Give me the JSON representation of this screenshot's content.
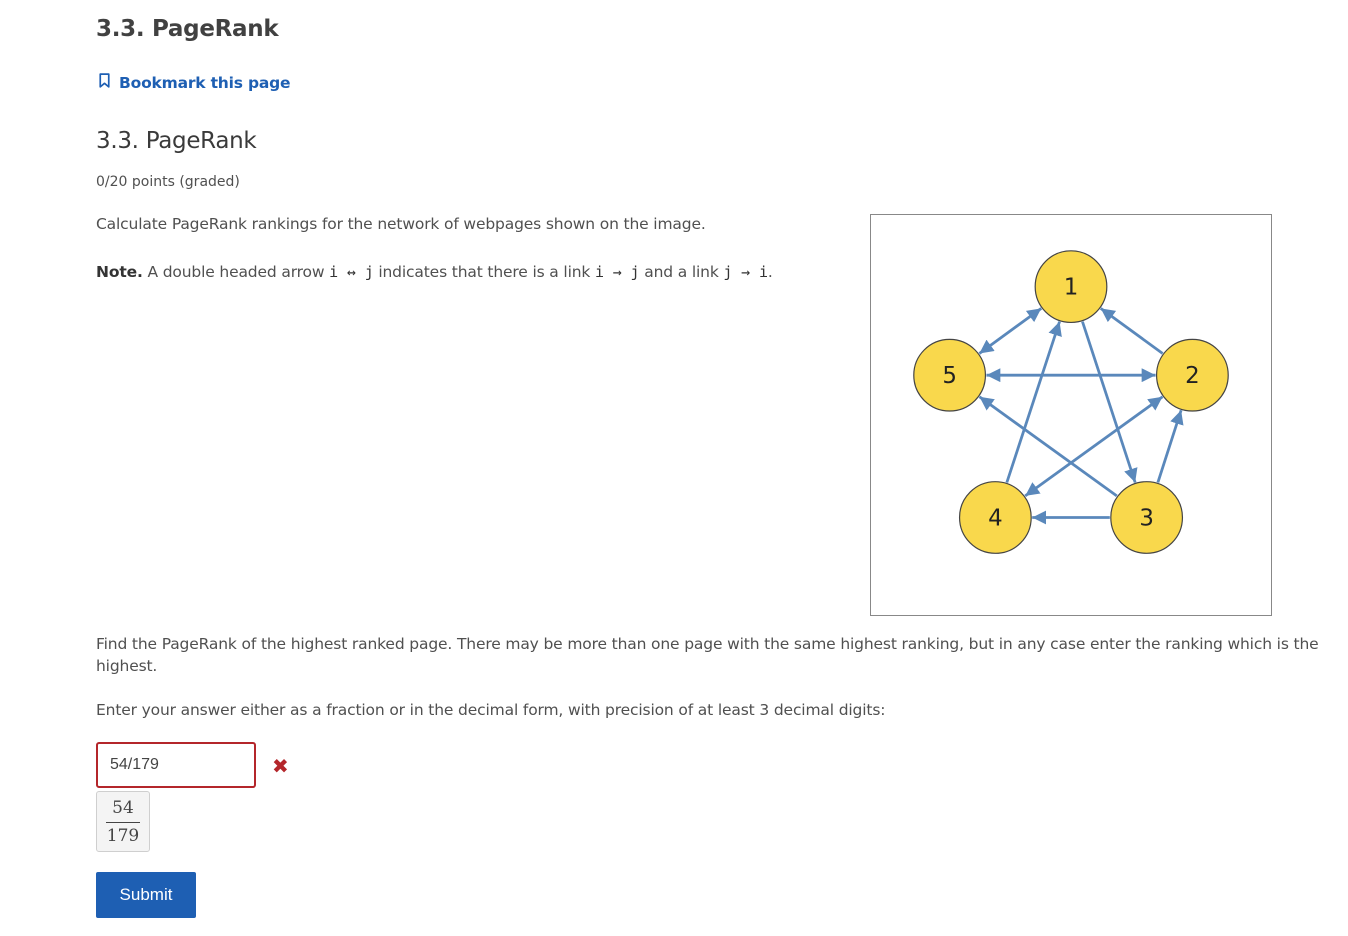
{
  "unit": {
    "title": "3.3. PageRank"
  },
  "bookmark": {
    "label": "Bookmark this page",
    "icon": "bookmark-icon"
  },
  "problem": {
    "title": "3.3. PageRank",
    "points": "0/20 points (graded)",
    "instruction": "Calculate PageRank rankings for the network of webpages shown on the image.",
    "note": {
      "label": "Note.",
      "t1": " A double headed arrow ",
      "m1": "i ↔ j",
      "t2": " indicates that there is a link ",
      "m2": "i → j",
      "t3": " and a link ",
      "m3": "j → i",
      "t4": "."
    },
    "question": "Find the PageRank of the highest ranked page. There may be more than one page with the same highest ranking, but in any case enter the ranking which is the highest.",
    "enter": "Enter your answer either as a fraction or in the decimal form, with precision of at least 3 decimal digits:"
  },
  "graph": {
    "nodes": [
      "1",
      "2",
      "3",
      "4",
      "5"
    ],
    "node_color": "#f9d84c",
    "edge_color": "#5a88bb",
    "edges": [
      [
        "2",
        "1"
      ],
      [
        "1",
        "3"
      ],
      [
        "4",
        "1"
      ],
      [
        "1",
        "5"
      ],
      [
        "5",
        "1"
      ],
      [
        "2",
        "5"
      ],
      [
        "5",
        "2"
      ],
      [
        "3",
        "2"
      ],
      [
        "4",
        "2"
      ],
      [
        "2",
        "4"
      ],
      [
        "3",
        "4"
      ],
      [
        "3",
        "5"
      ]
    ]
  },
  "answer": {
    "value": "54/179",
    "status": "incorrect",
    "status_icon": "incorrect-x-icon",
    "preview_numerator": "54",
    "preview_denominator": "179"
  },
  "submit": {
    "label": "Submit"
  },
  "colors": {
    "accent": "#1e5fb3",
    "error": "#b4262b"
  }
}
